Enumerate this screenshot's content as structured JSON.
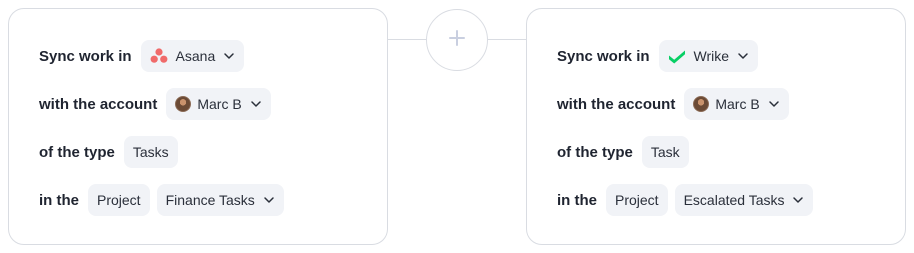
{
  "left": {
    "sync_label": "Sync work in",
    "app": "Asana",
    "account_label": "with the account",
    "account": "Marc B",
    "type_label": "of the type",
    "type": "Tasks",
    "in_label": "in the",
    "container": "Project",
    "project": "Finance Tasks"
  },
  "right": {
    "sync_label": "Sync work in",
    "app": "Wrike",
    "account_label": "with the account",
    "account": "Marc B",
    "type_label": "of the type",
    "type": "Task",
    "in_label": "in the",
    "container": "Project",
    "project": "Escalated Tasks"
  },
  "icons": {
    "asana": "asana-logo-icon",
    "wrike": "wrike-logo-icon",
    "chevron": "chevron-down-icon",
    "plus": "plus-icon",
    "avatar": "user-avatar"
  },
  "colors": {
    "asana": "#f06a6a",
    "wrike": "#08cf65",
    "plus": "#c9cfe0",
    "border": "#d9dce2",
    "chip_bg": "#f1f3f7"
  }
}
